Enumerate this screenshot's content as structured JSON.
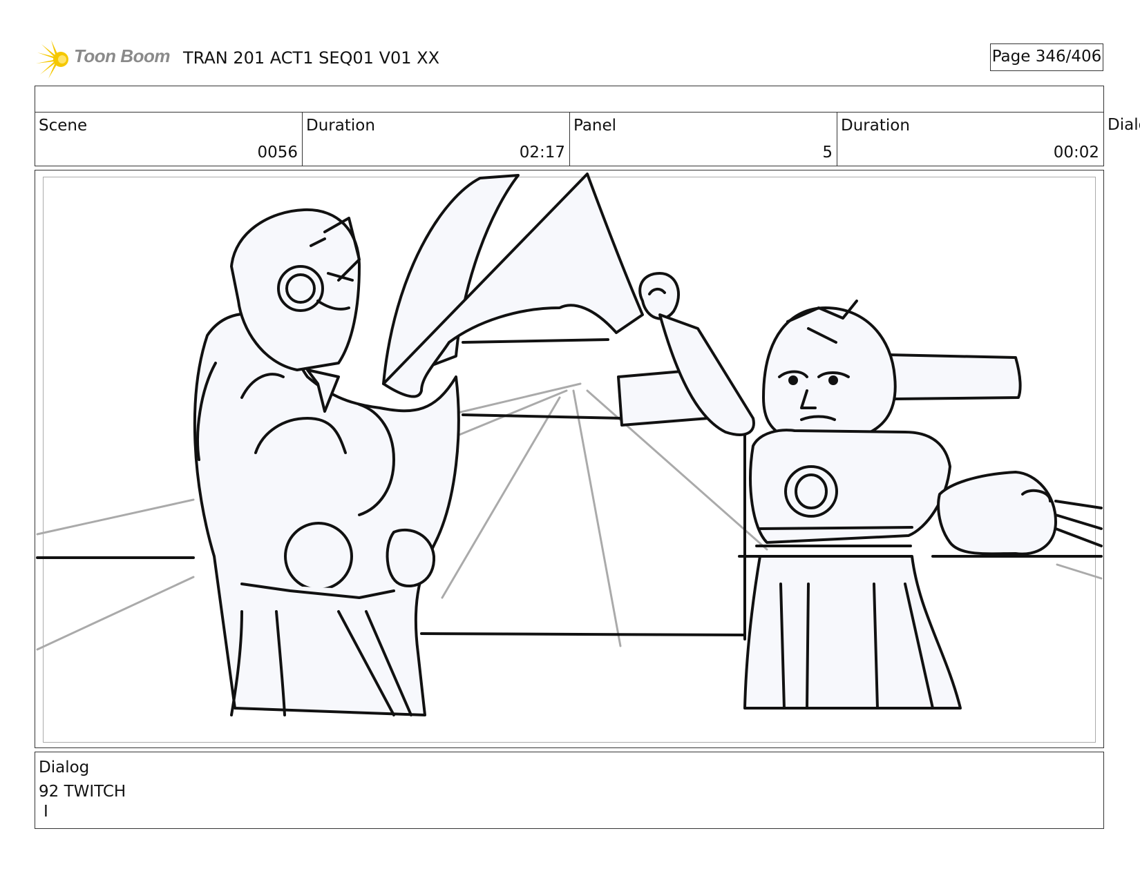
{
  "header": {
    "logo_text": "Toon Boom",
    "project_title": "TRAN 201 ACT1 SEQ01 V01 XX",
    "page_label": "Page 346/406"
  },
  "info": {
    "scene_label": "Scene",
    "scene_value": "0056",
    "scene_duration_label": "Duration",
    "scene_duration_value": "02:17",
    "panel_label": "Panel",
    "panel_value": "5",
    "panel_duration_label": "Duration",
    "panel_duration_value": "00:02",
    "overflow_label": "Dialo"
  },
  "panel": {
    "icon": "storyboard-sketch-robots"
  },
  "dialog": {
    "label": "Dialog",
    "line1": "92 TWITCH",
    "line2": "I"
  },
  "colors": {
    "logo_yellow": "#f5c800",
    "logo_gray": "#8a8a8a",
    "sketch_fill": "#f7f8fc",
    "perspective_gray": "#aaaaaa"
  }
}
